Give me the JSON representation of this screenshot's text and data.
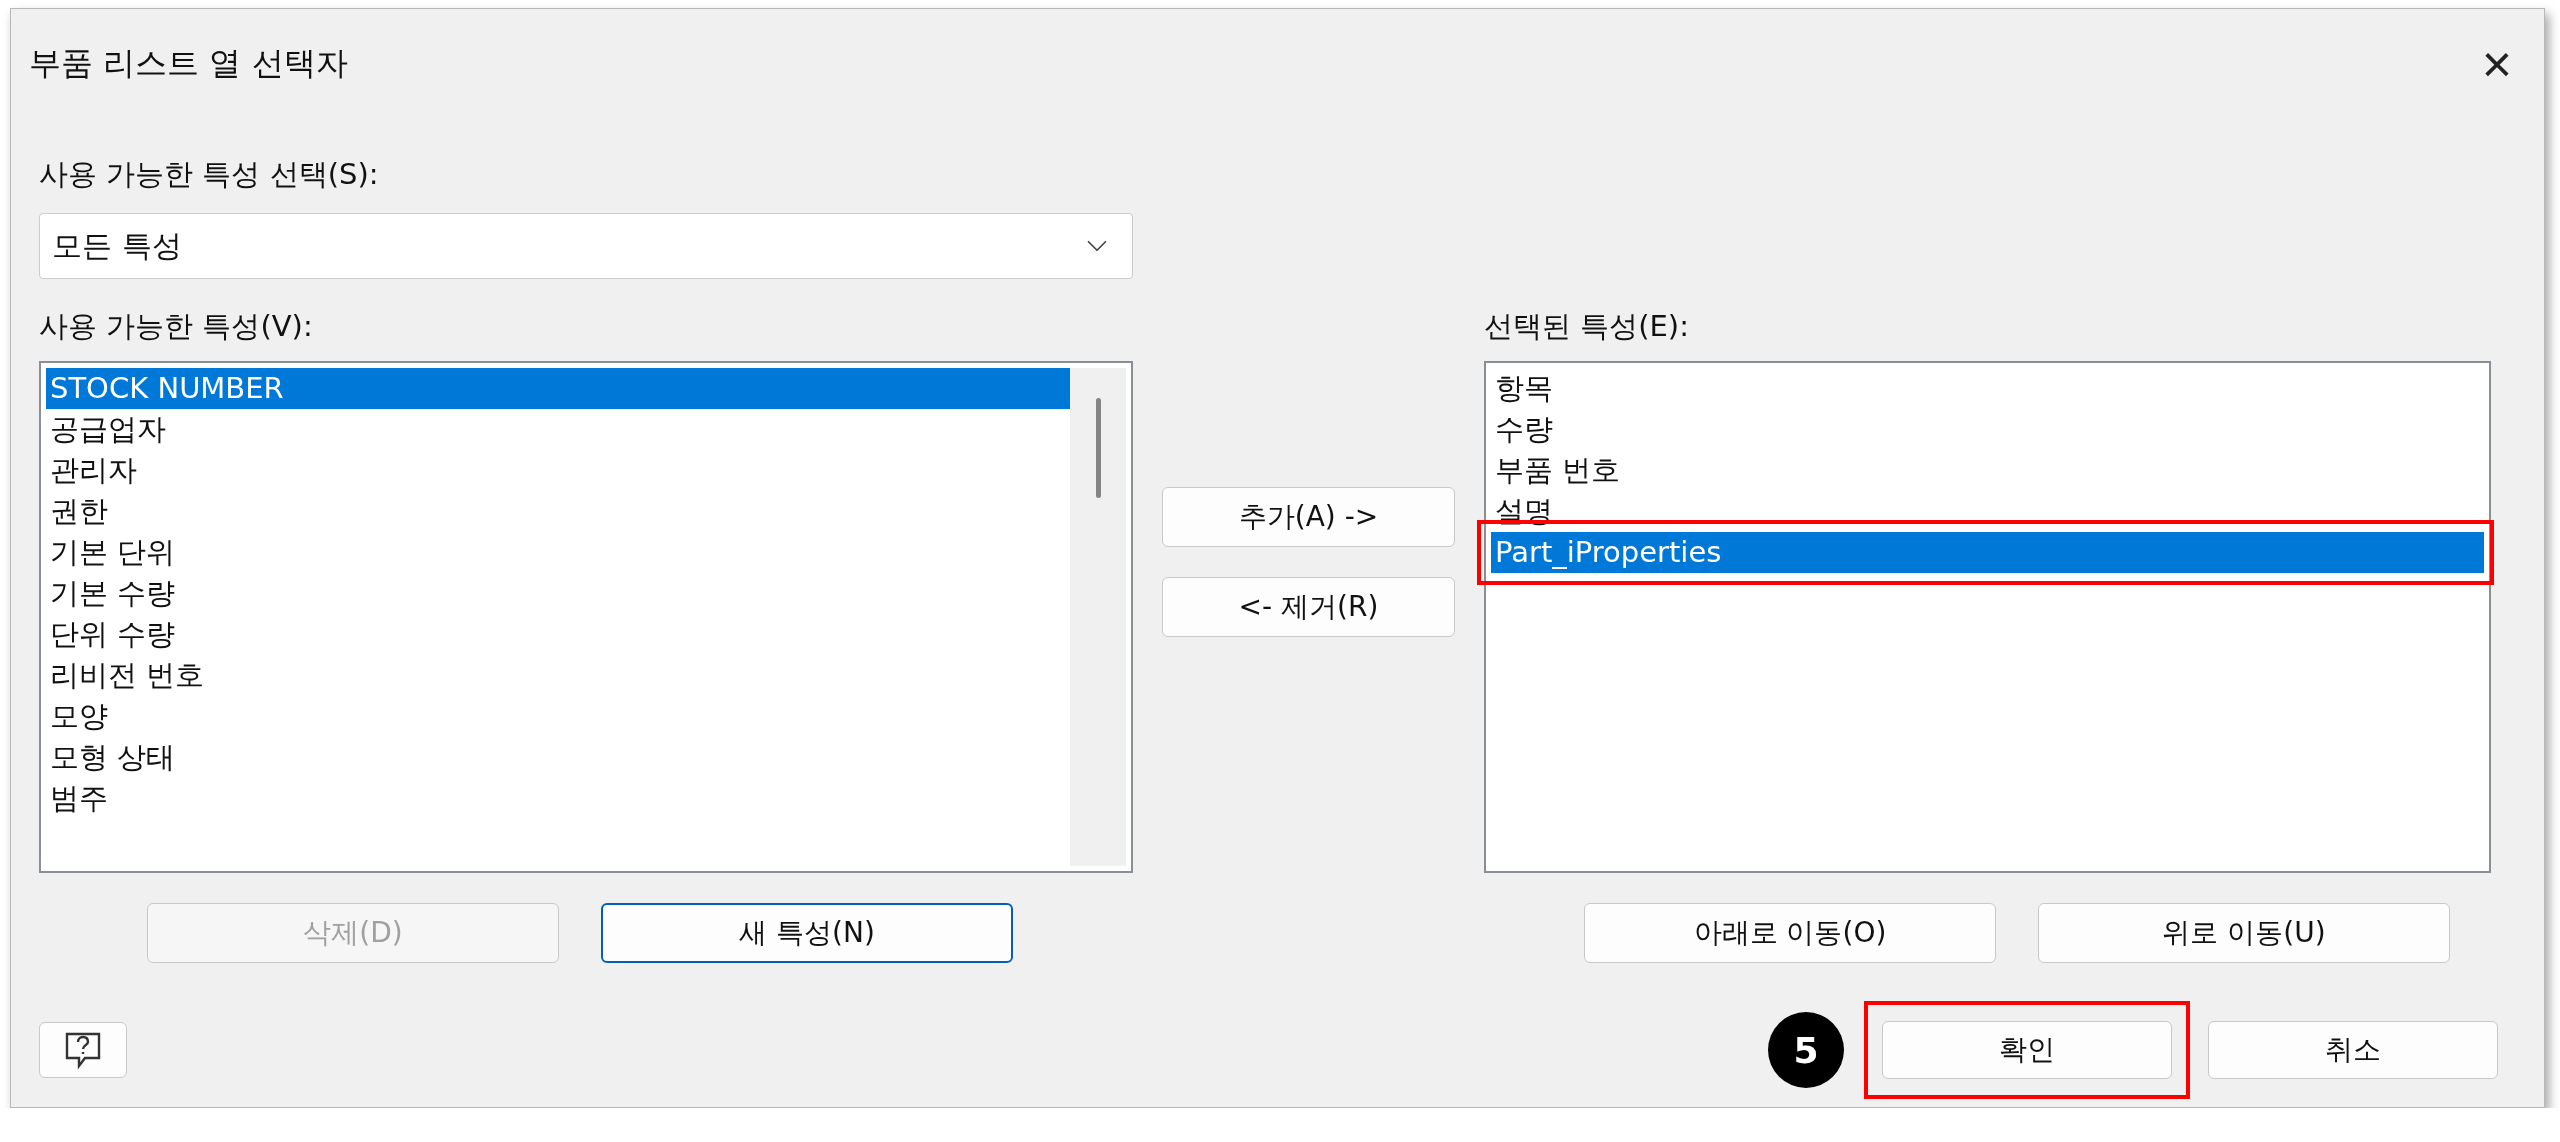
{
  "window": {
    "title": "부품 리스트 열 선택자",
    "close": "×"
  },
  "property_select": {
    "label": "사용 가능한 특성 선택(S):",
    "value": "모든 특성"
  },
  "available": {
    "label": "사용 가능한 특성(V):",
    "items": [
      {
        "text": "STOCK NUMBER",
        "selected": true,
        "highlighted": false
      },
      {
        "text": "공급업자",
        "selected": false,
        "highlighted": false
      },
      {
        "text": "관리자",
        "selected": false,
        "highlighted": false
      },
      {
        "text": "권한",
        "selected": false,
        "highlighted": false
      },
      {
        "text": "기본 단위",
        "selected": false,
        "highlighted": false
      },
      {
        "text": "기본 수량",
        "selected": false,
        "highlighted": false
      },
      {
        "text": "단위 수량",
        "selected": false,
        "highlighted": false
      },
      {
        "text": "리비전 번호",
        "selected": false,
        "highlighted": false
      },
      {
        "text": "모양",
        "selected": false,
        "highlighted": false
      },
      {
        "text": "모형 상태",
        "selected": false,
        "highlighted": false
      },
      {
        "text": "범주",
        "selected": false,
        "highlighted": false
      }
    ],
    "buttons": [
      {
        "label": "삭제(D)",
        "disabled": true,
        "focused": false
      },
      {
        "label": "새 특성(N)",
        "disabled": false,
        "focused": true
      }
    ]
  },
  "transfer_buttons": [
    {
      "label": "추가(A) ->"
    },
    {
      "label": "<- 제거(R)"
    }
  ],
  "selected": {
    "label": "선택된 특성(E):",
    "items": [
      {
        "text": "항목",
        "selected": false,
        "highlighted": false
      },
      {
        "text": "수량",
        "selected": false,
        "highlighted": false
      },
      {
        "text": "부품 번호",
        "selected": false,
        "highlighted": false
      },
      {
        "text": "설명",
        "selected": false,
        "highlighted": false
      },
      {
        "text": "Part_iProperties",
        "selected": true,
        "highlighted": true
      }
    ],
    "buttons": [
      {
        "label": "아래로 이동(O)",
        "disabled": false,
        "focused": false
      },
      {
        "label": "위로 이동(U)",
        "disabled": false,
        "focused": false
      }
    ]
  },
  "step_badge": "5",
  "footer_buttons": [
    {
      "label": "확인",
      "highlighted": true
    },
    {
      "label": "취소",
      "highlighted": false
    }
  ]
}
